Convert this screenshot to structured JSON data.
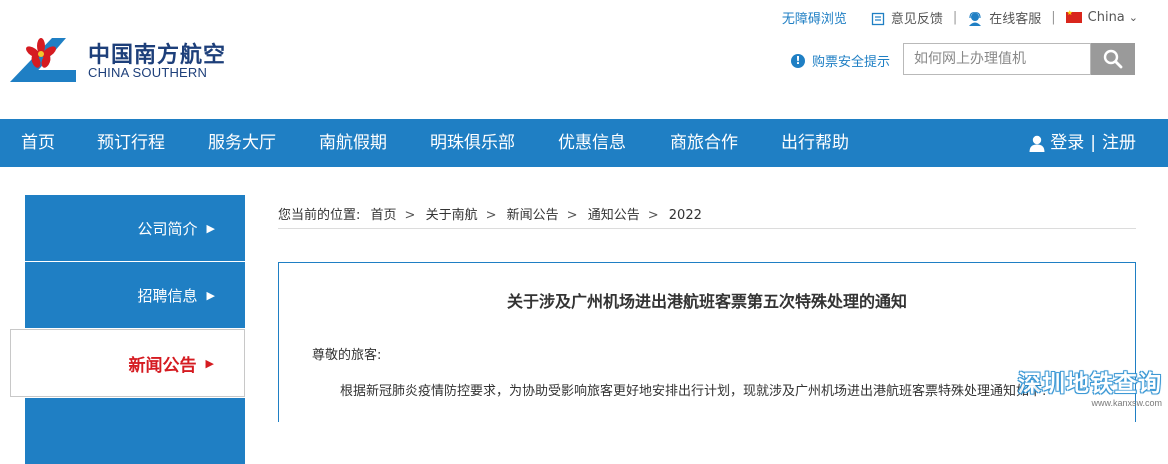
{
  "header": {
    "logo_cn": "中国南方航空",
    "logo_en": "CHINA SOUTHERN",
    "accessibility": "无障碍浏览",
    "feedback": "意见反馈",
    "online_service": "在线客服",
    "language": "China",
    "safety_tip": "购票安全提示",
    "search_placeholder": "如何网上办理值机"
  },
  "nav": {
    "items": [
      "首页",
      "预订行程",
      "服务大厅",
      "南航假期",
      "明珠俱乐部",
      "优惠信息",
      "商旅合作",
      "出行帮助"
    ],
    "login": "登录",
    "separator": "|",
    "register": "注册"
  },
  "sidebar": {
    "items": [
      {
        "label": "公司简介"
      },
      {
        "label": "招聘信息"
      },
      {
        "label": "新闻公告"
      }
    ]
  },
  "breadcrumb": {
    "prefix": "您当前的位置:",
    "items": [
      "首页",
      "关于南航",
      "新闻公告",
      "通知公告",
      "2022"
    ]
  },
  "article": {
    "title": "关于涉及广州机场进出港航班客票第五次特殊处理的通知",
    "greeting": "尊敬的旅客:",
    "paragraph": "根据新冠肺炎疫情防控要求，为协助受影响旅客更好地安排出行计划，现就涉及广州机场进出港航班客票特殊处理通知如下:"
  },
  "watermark": {
    "main": "深圳地铁查询",
    "url": "www.kanxsw.com"
  },
  "colors": {
    "brand_blue": "#1f7fc4",
    "active_red": "#d51b21",
    "logo_navy": "#1d3f7a"
  }
}
